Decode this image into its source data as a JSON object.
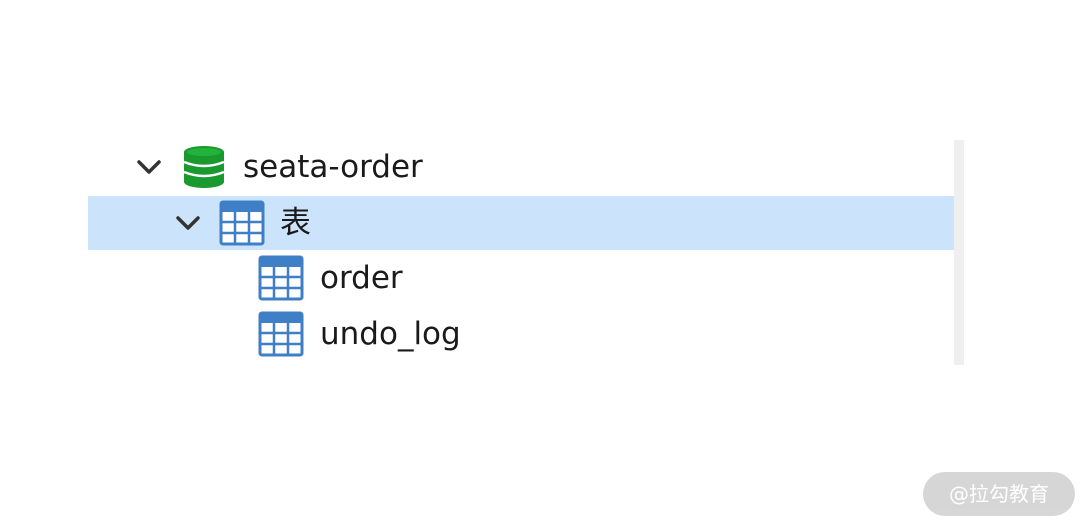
{
  "tree": {
    "nodes": [
      {
        "label": "seata-order",
        "icon": "database-icon",
        "expanded": true
      },
      {
        "label": "表",
        "icon": "table-folder-icon",
        "expanded": true,
        "selected": true
      },
      {
        "label": "order",
        "icon": "table-icon"
      },
      {
        "label": "undo_log",
        "icon": "table-icon"
      }
    ]
  },
  "watermark": {
    "text": "@拉勾教育"
  },
  "colors": {
    "selection": "#cce4fb",
    "database_green": "#1a9a2e",
    "table_blue": "#3f7fc6"
  }
}
